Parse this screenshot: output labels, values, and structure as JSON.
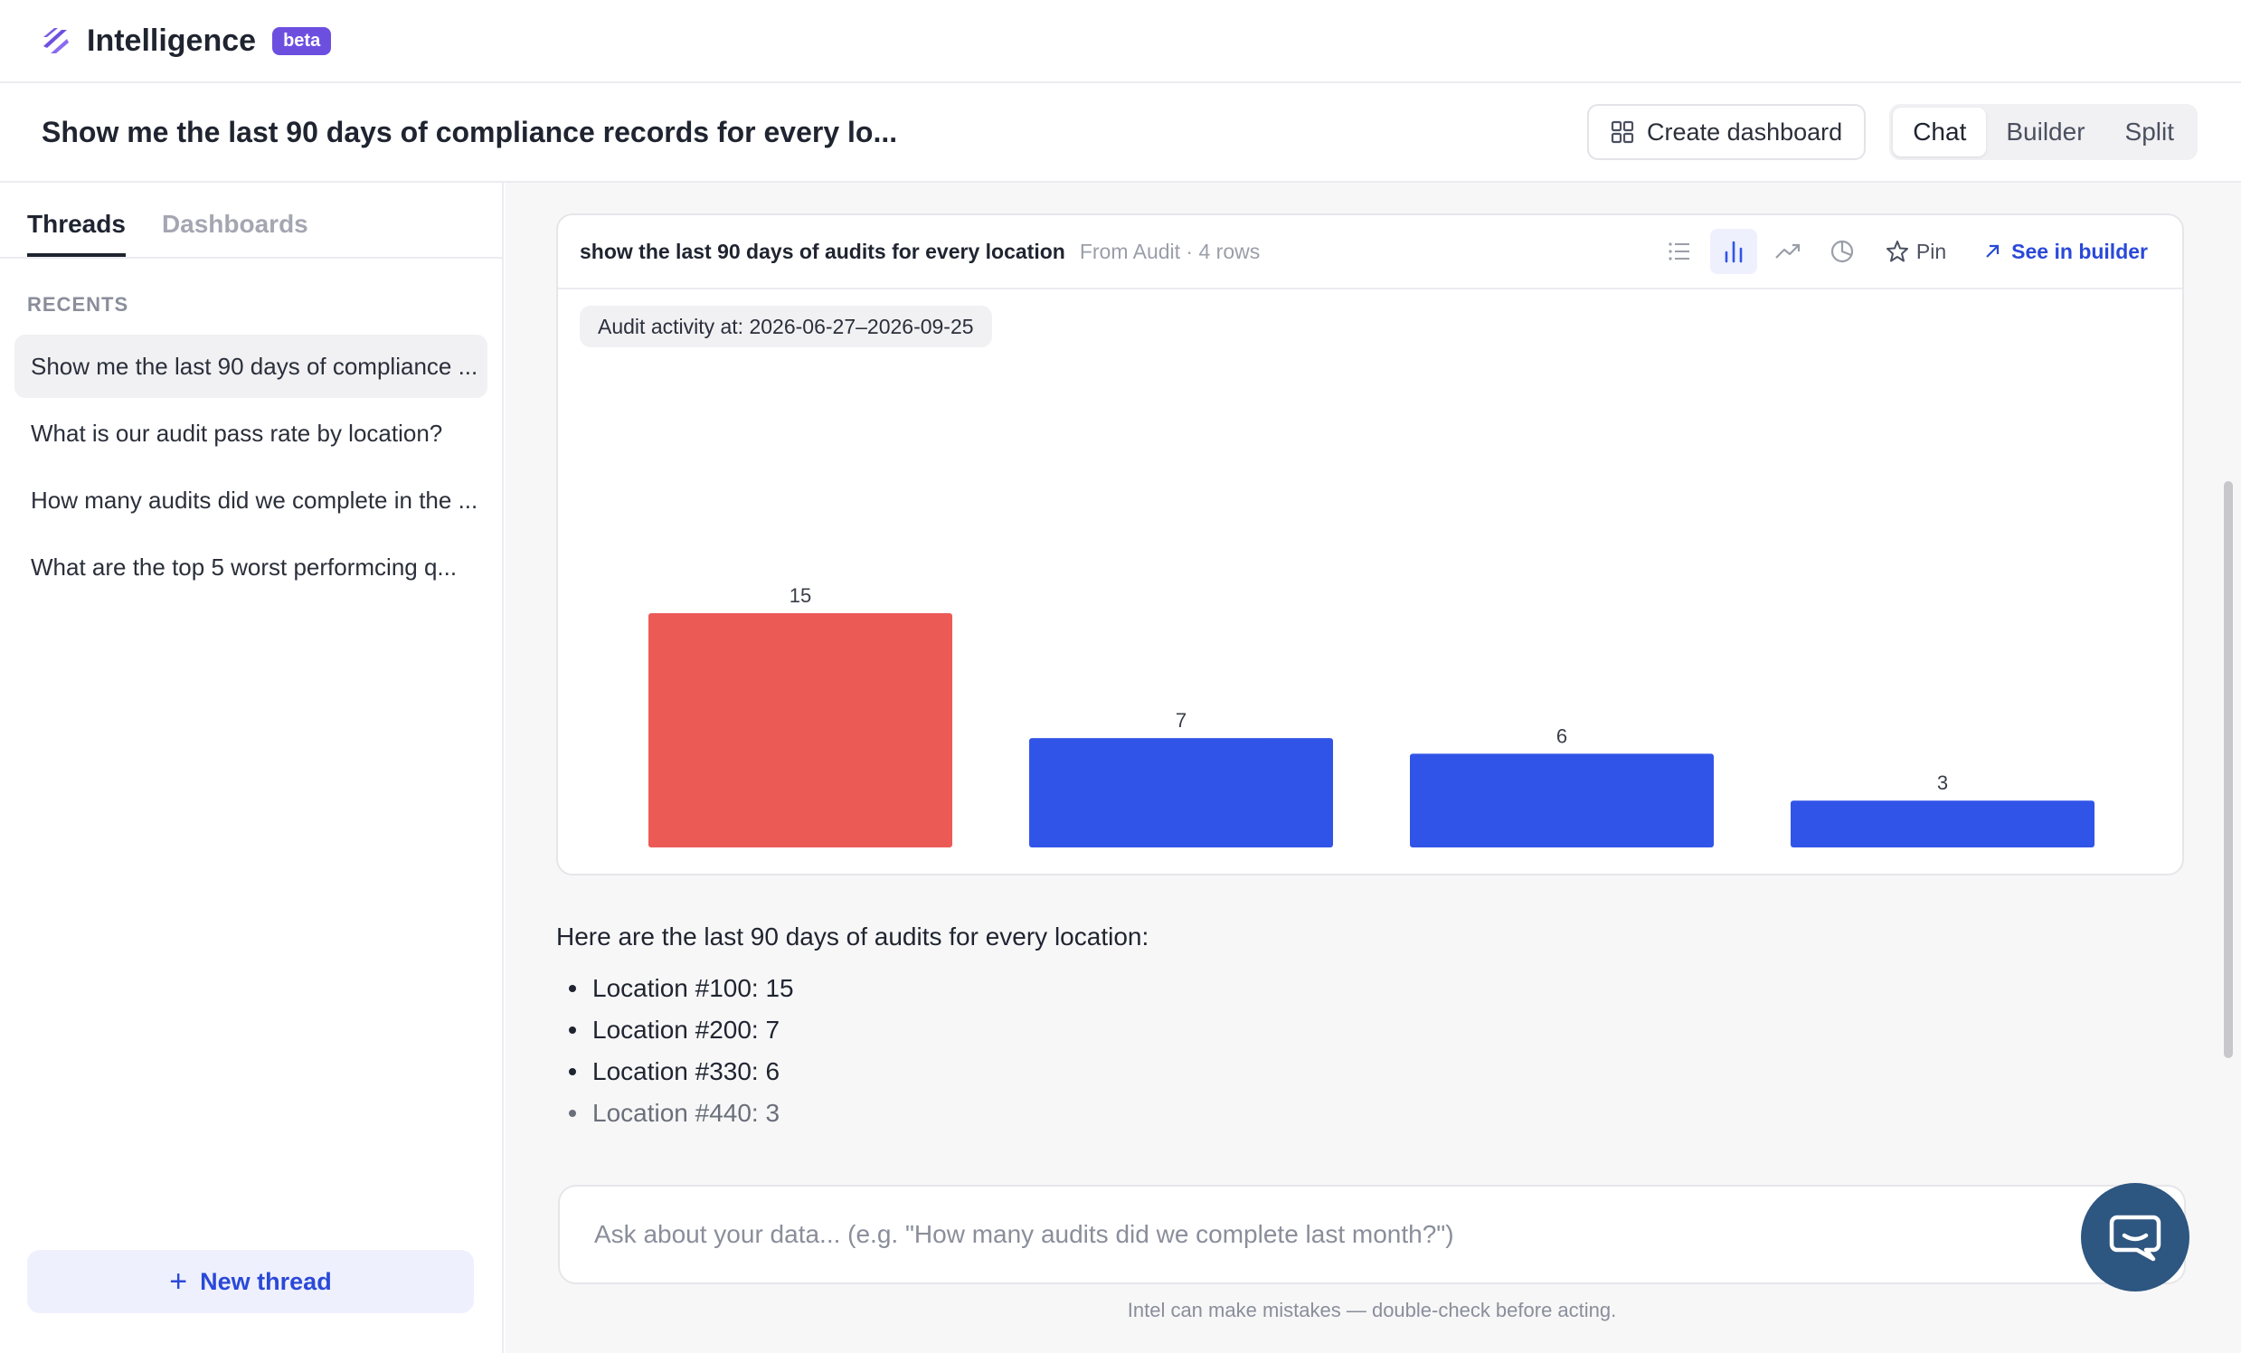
{
  "app": {
    "name": "Intelligence",
    "badge": "beta"
  },
  "thread": {
    "title": "Show me the last 90 days of compliance records for every lo..."
  },
  "toolbar": {
    "create_dashboard_label": "Create dashboard",
    "modes": [
      {
        "label": "Chat",
        "active": true
      },
      {
        "label": "Builder",
        "active": false
      },
      {
        "label": "Split",
        "active": false
      }
    ]
  },
  "sidebar": {
    "tabs": [
      {
        "label": "Threads",
        "active": true
      },
      {
        "label": "Dashboards",
        "active": false
      }
    ],
    "recents_label": "RECENTS",
    "recents": [
      {
        "label": "Show me the last 90 days of compliance ...",
        "active": true
      },
      {
        "label": "What is our audit pass rate by location?",
        "active": false
      },
      {
        "label": "How many audits did we complete in the ...",
        "active": false
      },
      {
        "label": "What are the top 5 worst performcing q...",
        "active": false
      }
    ],
    "new_thread_label": "New thread"
  },
  "card": {
    "title": "show the last 90 days of audits for every location",
    "meta": "From Audit · 4 rows",
    "pin_label": "Pin",
    "see_builder_label": "See in builder",
    "filter": "Audit activity at: 2026-06-27–2026-09-25",
    "icons": [
      "list-icon",
      "bar-chart-icon",
      "trend-line-icon",
      "pie-chart-icon",
      "star-icon",
      "arrow-up-right-icon"
    ]
  },
  "chart_data": {
    "type": "bar",
    "categories": [
      "Location #100",
      "Location #200",
      "Location #330",
      "Location #440"
    ],
    "values": [
      15,
      7,
      6,
      3
    ],
    "colors": [
      "#ec5a56",
      "#3154e8",
      "#3154e8",
      "#3154e8"
    ],
    "ylim": [
      0,
      15
    ],
    "grid": false,
    "data_labels": true
  },
  "answer": {
    "intro": "Here are the last 90 days of audits for every location:",
    "items": [
      "Location #100: 15",
      "Location #200: 7",
      "Location #330: 6",
      "Location #440: 3"
    ]
  },
  "input": {
    "placeholder": "Ask about your data... (e.g. \"How many audits did we complete last month?\")"
  },
  "disclaimer": "Intel can make mistakes — double-check before acting.",
  "colors": {
    "accent": "#2a49d8",
    "brand": "#6d4fe0",
    "highlight_bar": "#ec5a56",
    "bar": "#3154e8",
    "chat_button": "#2d5680"
  }
}
